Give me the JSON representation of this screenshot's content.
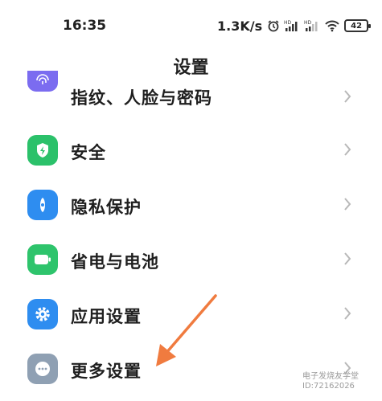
{
  "status_bar": {
    "time": "16:35",
    "net_speed": "1.3K/s",
    "battery": "42",
    "icons": [
      "alarm-icon",
      "hd-signal-icon",
      "hd-signal-icon",
      "wifi-icon",
      "battery-icon"
    ]
  },
  "header": {
    "title": "设置"
  },
  "settings": {
    "items": [
      {
        "label": "指纹、人脸与密码",
        "icon": "fingerprint-icon",
        "color": "#7b6cf0"
      },
      {
        "label": "安全",
        "icon": "shield-bolt-icon",
        "color": "#2bc16a"
      },
      {
        "label": "隐私保护",
        "icon": "privacy-icon",
        "color": "#2e8df0"
      },
      {
        "label": "省电与电池",
        "icon": "battery-saver-icon",
        "color": "#2ec46c"
      },
      {
        "label": "应用设置",
        "icon": "gear-icon",
        "color": "#2e8df0"
      },
      {
        "label": "更多设置",
        "icon": "more-icon",
        "color": "#8fa0b3"
      }
    ]
  },
  "annotation": {
    "arrow_color": "#f07b3f"
  },
  "watermark": {
    "line1": "电子发烧友学堂",
    "line2": "ID:72162026"
  }
}
